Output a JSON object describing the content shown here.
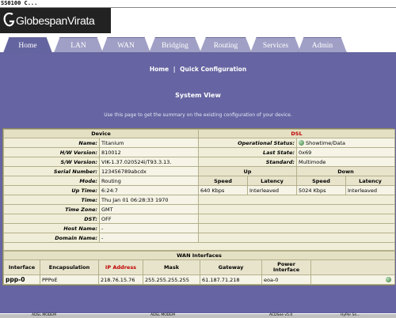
{
  "window": {
    "title": "SS0100 C..."
  },
  "brand": {
    "logo_text": "GlobespanVirata"
  },
  "tabs": [
    {
      "label": "Home",
      "active": true
    },
    {
      "label": "LAN"
    },
    {
      "label": "WAN"
    },
    {
      "label": "Bridging"
    },
    {
      "label": "Routing"
    },
    {
      "label": "Services"
    },
    {
      "label": "Admin"
    }
  ],
  "breadcrumb": {
    "home": "Home",
    "separator": "|",
    "current": "Quick Configuration"
  },
  "page": {
    "title": "System View",
    "description": "Use this page to get the summary on the existing configuration of your device."
  },
  "device": {
    "header": "Device",
    "rows": [
      {
        "label": "Name:",
        "value": "Titanium"
      },
      {
        "label": "H/W Version:",
        "value": "810012"
      },
      {
        "label": "S/W Version:",
        "value": "VIK-1.37.020524i/T93.3.13."
      },
      {
        "label": "Serial Number:",
        "value": "123456789abcdx"
      },
      {
        "label": "Mode:",
        "value": "Routing"
      },
      {
        "label": "Up Time:",
        "value": "6:24:7"
      },
      {
        "label": "Time:",
        "value": "Thu Jan 01 06:28:33 1970"
      },
      {
        "label": "Time Zone:",
        "value": "GMT"
      },
      {
        "label": "DST:",
        "value": "OFF"
      },
      {
        "label": "Host Name:",
        "value": "-"
      },
      {
        "label": "Domain Name:",
        "value": "-"
      }
    ]
  },
  "dsl": {
    "header": "DSL",
    "status": [
      {
        "label": "Operational Status:",
        "value": "Showtime/Data"
      },
      {
        "label": "Last State:",
        "value": "0x69"
      },
      {
        "label": "Standard:",
        "value": "Multimode"
      }
    ],
    "up_label": "Up",
    "down_label": "Down",
    "speed_label": "Speed",
    "latency_label": "Latency",
    "up_speed": "640 Kbps",
    "up_latency": "Interleaved",
    "down_speed": "5024 Kbps",
    "down_latency": "Interleaved"
  },
  "wan": {
    "header": "WAN Interfaces",
    "columns": {
      "interface": "Interface",
      "encapsulation": "Encapsulation",
      "ip": "IP Address",
      "mask": "Mask",
      "gateway": "Gateway",
      "power": "Power Interface"
    },
    "rows": [
      {
        "interface": "ppp-0",
        "encapsulation": "PPPoE",
        "ip": "218.76.15.76",
        "mask": "255.255.255.255",
        "gateway": "61.187.71.218",
        "power": "eoa-0"
      }
    ]
  },
  "taskbar": {
    "items": [
      "ADSL MODEM",
      "ADSL MODEM",
      "ACDSee v5.0",
      "HyPer Sn..."
    ]
  },
  "colors": {
    "purple": "#6664a2",
    "tab": "#a0a0c6",
    "panel": "#f0eed8",
    "accent_red": "#c00000"
  }
}
